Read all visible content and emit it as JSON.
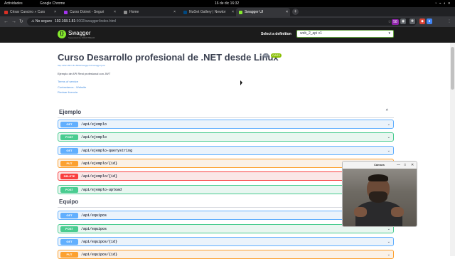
{
  "gnome": {
    "activities": "Actividades",
    "app": "Google Chrome",
    "clock": "16 de dic 16:32",
    "sys_icons": "◔ ⌁ ◐ ▾"
  },
  "tabs": [
    {
      "title": "César Cancino » Curs",
      "favcolor": "#d93025"
    },
    {
      "title": "Curso Dotnet - Seguri",
      "favcolor": "#a435f0"
    },
    {
      "title": "Home",
      "favcolor": "#8e8e8e"
    },
    {
      "title": "NuGet Gallery | Newtor",
      "favcolor": "#004880"
    },
    {
      "title": "Swagger UI",
      "favcolor": "#85ea2d"
    }
  ],
  "newtab": "+",
  "toolbar": {
    "back": "←",
    "forward": "→",
    "reload": "↻",
    "not_secure": "⚠ No seguro",
    "host": "192.168.1.81",
    "path": ":5002/swagger/index.html"
  },
  "ext": [
    {
      "icon": "star-icon",
      "glyph": "☆",
      "color": "#5f6368"
    },
    {
      "icon": "extension-icon",
      "glyph": "◆",
      "color": "#db4437"
    },
    {
      "icon": "extension-icon",
      "glyph": "●",
      "color": "#4285f4"
    },
    {
      "icon": "badge-icon",
      "glyph": "58",
      "color": "#8e24aa"
    },
    {
      "icon": "extension-icon",
      "glyph": "◉",
      "color": "#5f6368"
    },
    {
      "icon": "puzzle-icon",
      "glyph": "✚",
      "color": "#5f6368"
    },
    {
      "icon": "menu-icon",
      "glyph": "⋮",
      "color": "#5f6368"
    }
  ],
  "swagger": {
    "logo_glyph": "{}",
    "name": "Swagger",
    "sub": "Supported by SMARTBEAR",
    "def_label": "Select a definition",
    "def_value": "web_2_api v1",
    "caret": "▾"
  },
  "info": {
    "title": "Curso Desarrollo profesional de .NET desde Linux",
    "version": "v1",
    "oas": "OAS3",
    "url": "http://192.168.1.81:5002/swagger/v1/swagger.json",
    "description": "Ejemplo de API Rest profesional con JWT",
    "terms": "Terms of service",
    "contact": "Contactanos - Website",
    "license": "Revisar licencia"
  },
  "sections": [
    {
      "name": "Ejemplo",
      "chevron": "^"
    },
    {
      "name": "Equipo",
      "chevron": "^"
    }
  ],
  "ops": [
    {
      "method": "GET",
      "cls": "get",
      "path": "/api/ejemplo"
    },
    {
      "method": "POST",
      "cls": "post",
      "path": "/api/ejemplo"
    },
    {
      "method": "GET",
      "cls": "get",
      "path": "/api/ejemplo-querystring"
    },
    {
      "method": "PUT",
      "cls": "put",
      "path": "/api/ejemplo/{id}"
    },
    {
      "method": "DELETE",
      "cls": "del",
      "path": "/api/ejemplo/{id}"
    },
    {
      "method": "POST",
      "cls": "post",
      "path": "/api/ejemplo-upload"
    },
    {
      "method": "GET",
      "cls": "get",
      "path": "/api/equipos"
    },
    {
      "method": "POST",
      "cls": "post",
      "path": "/api/equipos"
    },
    {
      "method": "GET",
      "cls": "get",
      "path": "/api/equipos/{id}"
    },
    {
      "method": "PUT",
      "cls": "put",
      "path": "/api/equipos/{id}"
    }
  ],
  "op_chevron": "⌄",
  "camera": {
    "title": "Cámara",
    "minimize": "—",
    "maximize": "□",
    "close": "✕"
  },
  "colors": {
    "get": "#61affe",
    "post": "#49cc90",
    "put": "#fca130",
    "delete": "#f93e3e",
    "swagger_green": "#85ea2d",
    "badge_version": "#7d8492",
    "badge_oas": "#89bf04"
  }
}
